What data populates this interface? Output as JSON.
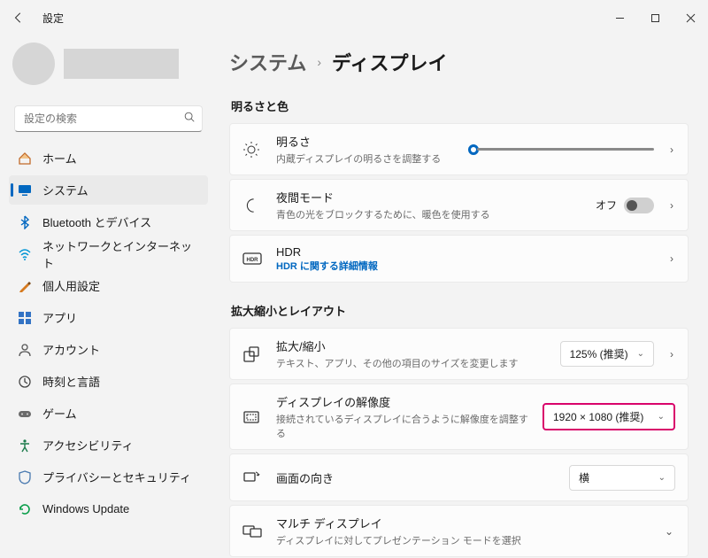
{
  "window": {
    "title": "設定"
  },
  "search": {
    "placeholder": "設定の検索"
  },
  "nav": {
    "home": "ホーム",
    "system": "システム",
    "bluetooth": "Bluetooth とデバイス",
    "network": "ネットワークとインターネット",
    "personalization": "個人用設定",
    "apps": "アプリ",
    "accounts": "アカウント",
    "time": "時刻と言語",
    "gaming": "ゲーム",
    "accessibility": "アクセシビリティ",
    "privacy": "プライバシーとセキュリティ",
    "update": "Windows Update"
  },
  "breadcrumb": {
    "parent": "システム",
    "current": "ディスプレイ"
  },
  "sections": {
    "brightness": "明るさと色",
    "scale": "拡大縮小とレイアウト"
  },
  "cards": {
    "brightness": {
      "title": "明るさ",
      "sub": "内蔵ディスプレイの明るさを調整する"
    },
    "nightlight": {
      "title": "夜間モード",
      "sub": "青色の光をブロックするために、暖色を使用する",
      "toggle_label": "オフ"
    },
    "hdr": {
      "title": "HDR",
      "link": "HDR に関する詳細情報"
    },
    "scale": {
      "title": "拡大/縮小",
      "sub": "テキスト、アプリ、その他の項目のサイズを変更します",
      "value": "125% (推奨)"
    },
    "resolution": {
      "title": "ディスプレイの解像度",
      "sub": "接続されているディスプレイに合うように解像度を調整する",
      "value": "1920 × 1080 (推奨)"
    },
    "orientation": {
      "title": "画面の向き",
      "value": "横"
    },
    "multi": {
      "title": "マルチ ディスプレイ",
      "sub": "ディスプレイに対してプレゼンテーション モードを選択"
    }
  }
}
